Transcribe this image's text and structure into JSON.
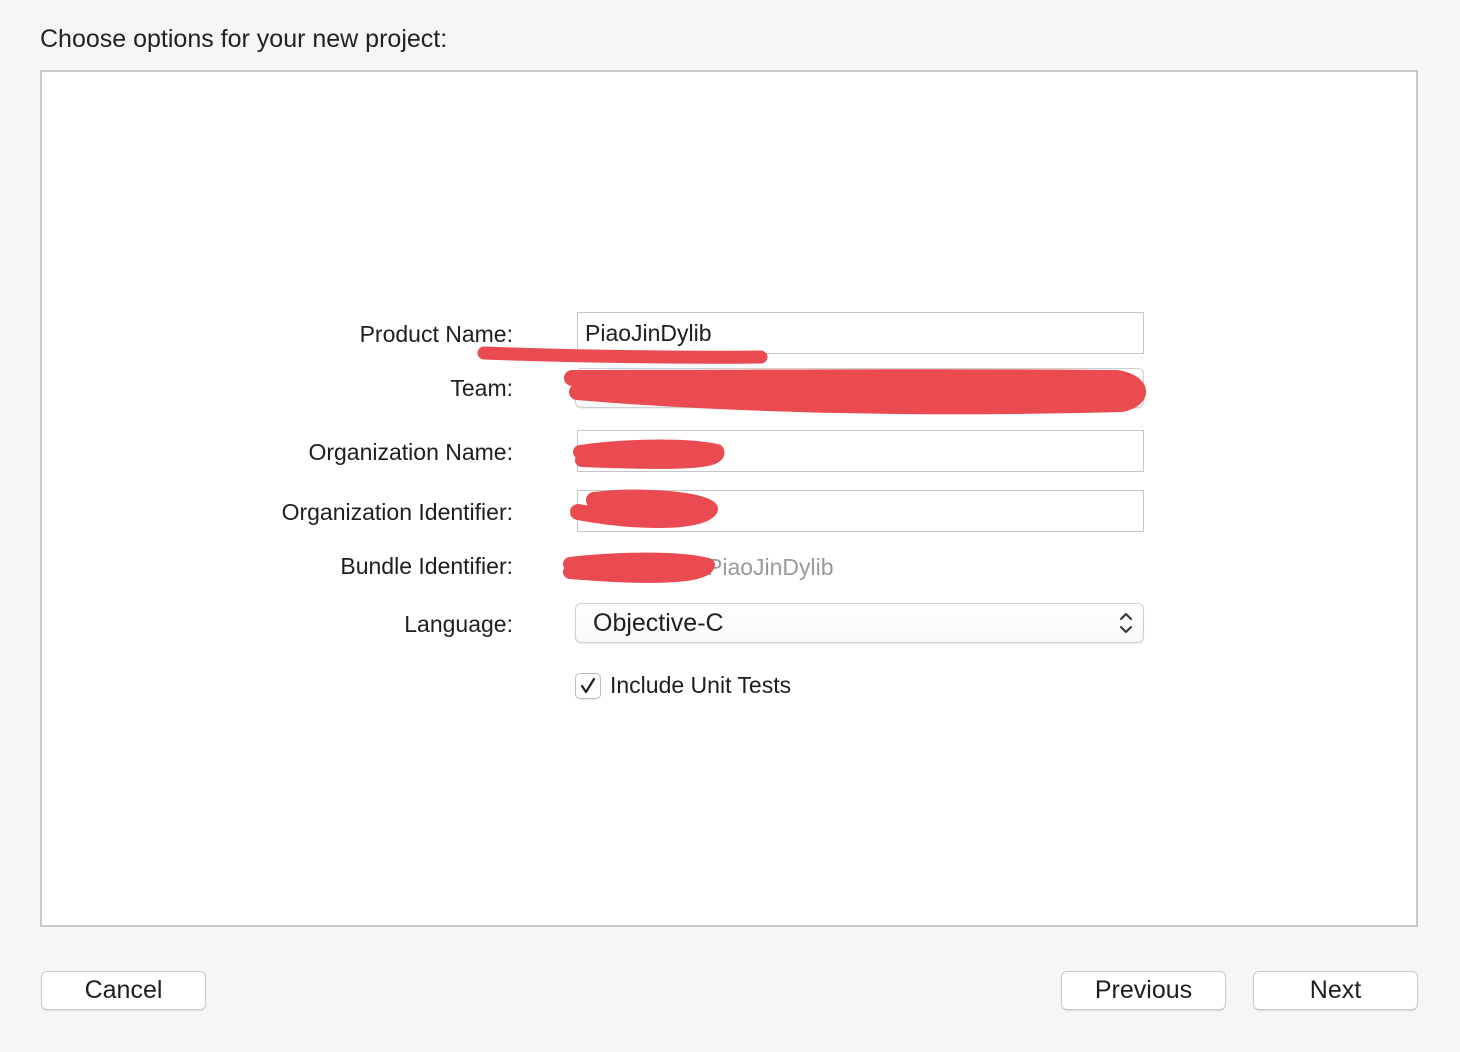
{
  "header": {
    "title": "Choose options for your new project:"
  },
  "form": {
    "product_name": {
      "label": "Product Name:",
      "value": "PiaoJinDylib"
    },
    "team": {
      "label": "Team:",
      "value": ""
    },
    "organization_name": {
      "label": "Organization Name:",
      "value": ""
    },
    "organization_identifier": {
      "label": "Organization Identifier:",
      "value": ""
    },
    "bundle_identifier": {
      "label": "Bundle Identifier:",
      "value": "PiaoJinDylib"
    },
    "language": {
      "label": "Language:",
      "value": "Objective-C"
    },
    "include_unit_tests": {
      "label": "Include Unit Tests",
      "checked": true
    }
  },
  "footer": {
    "cancel_label": "Cancel",
    "previous_label": "Previous",
    "next_label": "Next"
  },
  "colors": {
    "redaction": "#e94b50",
    "background": "#f6f6f6",
    "panel": "#ffffff"
  }
}
